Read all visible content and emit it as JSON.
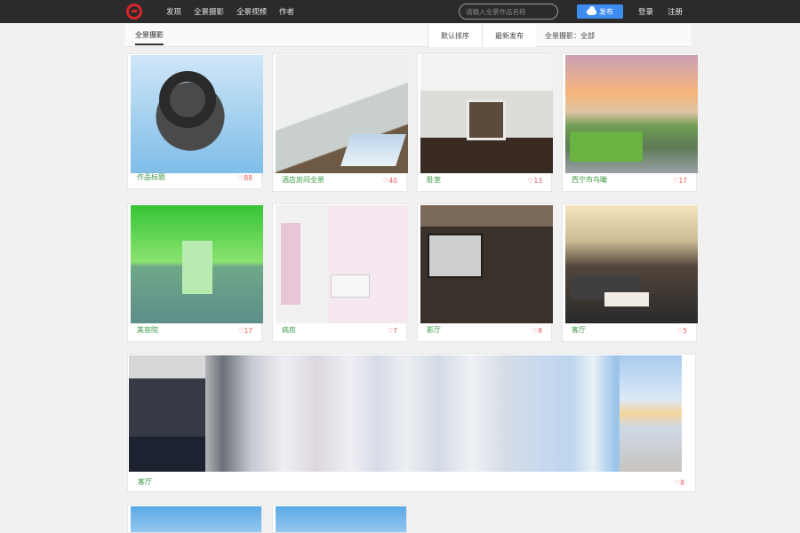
{
  "header": {
    "nav": [
      "发现",
      "全景摄影",
      "全景视频",
      "作者"
    ],
    "search_placeholder": "请输入全景作品名称",
    "publish_label": "发布",
    "login_label": "登录",
    "register_label": "注册"
  },
  "tabs": {
    "active": "全景摄影",
    "filters": [
      "默认排序",
      "最新发布",
      "全景摄影：全部"
    ]
  },
  "cards": [
    {
      "title": "作品标题",
      "likes": "♡88"
    },
    {
      "title": "酒店房间全景",
      "likes": "♡40"
    },
    {
      "title": "卧室",
      "likes": "♡13"
    },
    {
      "title": "西宁市鸟瞰",
      "likes": "♡17"
    },
    {
      "title": "美容院",
      "likes": "♡17"
    },
    {
      "title": "病房",
      "likes": "♡7"
    },
    {
      "title": "影厅",
      "likes": "♡8"
    },
    {
      "title": "客厅",
      "likes": "♡5"
    }
  ],
  "wide_card": {
    "title": "客厅",
    "likes": "♡8"
  }
}
